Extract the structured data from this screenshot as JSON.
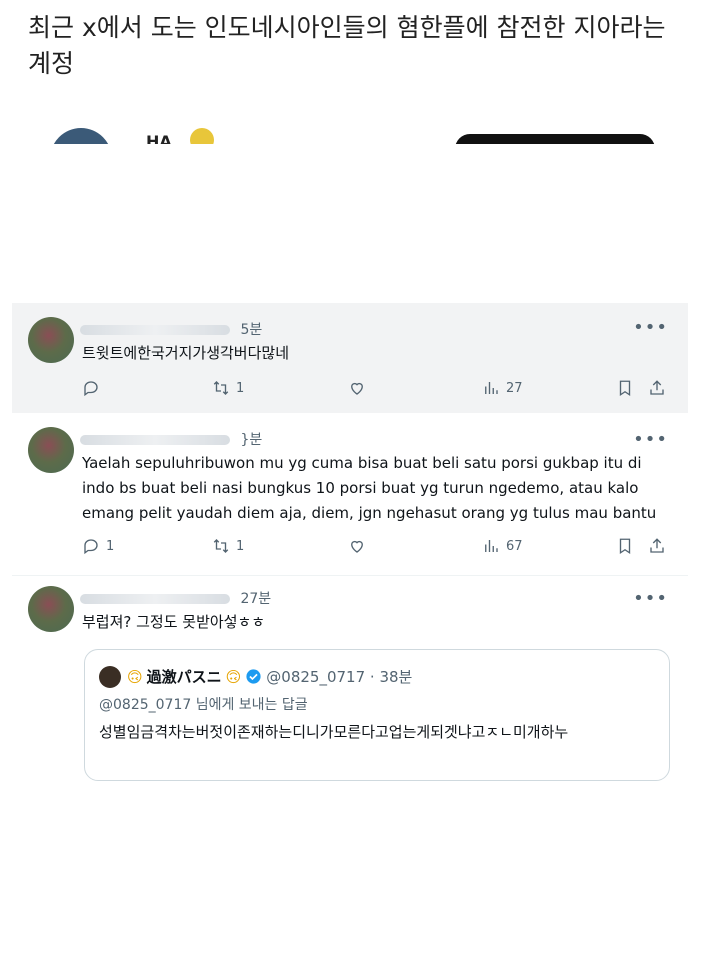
{
  "headline": "최근 x에서 도는 인도네시아인들의 혐한플에 참전한 지아라는 계정",
  "tweets": [
    {
      "time": "5분",
      "text": "트윗트에한국거지가생각버다많네",
      "reply_count": "",
      "retweet_count": "1",
      "like_count": "",
      "view_count": "27"
    },
    {
      "time": "}분",
      "text": "Yaelah sepuluhribuwon mu yg cuma bisa buat beli satu porsi gukbap itu di indo bs buat beli nasi bungkus 10 porsi buat yg turun ngedemo, atau kalo emang pelit yaudah diem aja, diem, jgn ngehasut orang yg tulus mau bantu",
      "reply_count": "1",
      "retweet_count": "1",
      "like_count": "",
      "view_count": "67"
    },
    {
      "time": "27분",
      "text": "부럽져? 그정도 못받아섷ㅎㅎ"
    }
  ],
  "quote": {
    "name": "過激パスニ",
    "handle": "@0825_0717 · 38분",
    "reply_to": "@0825_0717 님에게 보내는 답글",
    "text": "성별임금격차는버젓이존재하는디니가모른다고업는게되겟냐고ㅈㄴ미개하누"
  },
  "icons": [
    "more-icon",
    "reply-icon",
    "retweet-icon",
    "like-icon",
    "views-icon",
    "bookmark-icon",
    "share-icon",
    "verified-icon"
  ]
}
